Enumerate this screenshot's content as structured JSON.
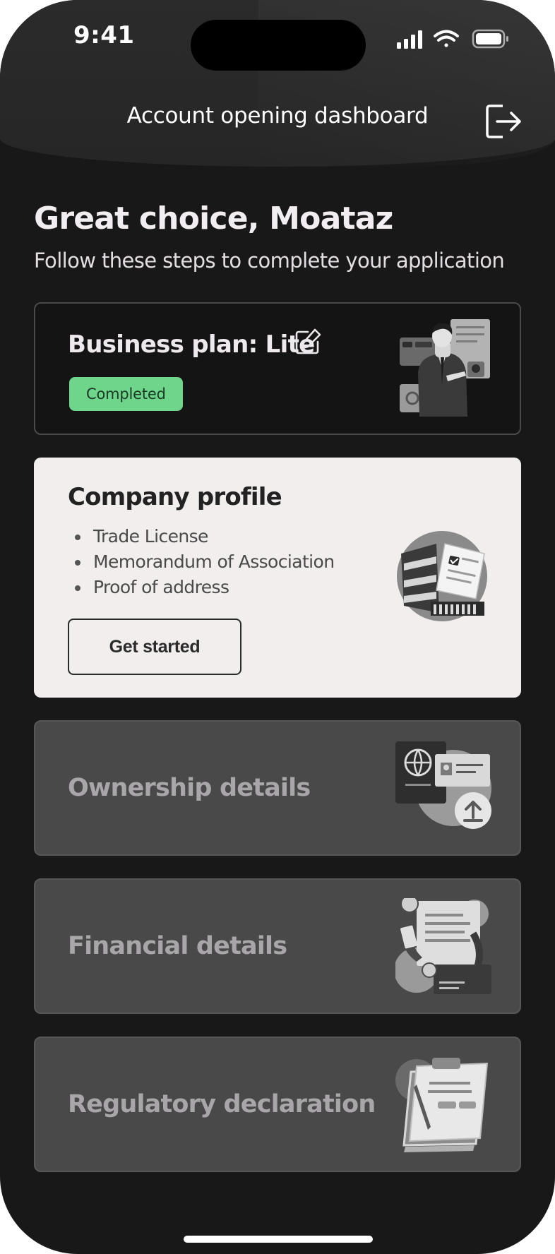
{
  "status_bar": {
    "time": "9:41"
  },
  "header": {
    "title": "Account opening dashboard"
  },
  "greeting": {
    "title": "Great choice, Moataz",
    "subtitle": "Follow these steps to complete your application"
  },
  "plan_card": {
    "title": "Business plan: Lite",
    "status": "Completed",
    "status_color": "#6ed58b"
  },
  "profile_card": {
    "title": "Company profile",
    "requirements": [
      "Trade License",
      "Memorandum of Association",
      "Proof of address"
    ],
    "button_label": "Get started"
  },
  "locked_steps": [
    {
      "title": "Ownership details",
      "icon": "passport-upload-icon"
    },
    {
      "title": "Financial details",
      "icon": "financial-document-icon"
    },
    {
      "title": "Regulatory declaration",
      "icon": "clipboard-declaration-icon"
    }
  ]
}
